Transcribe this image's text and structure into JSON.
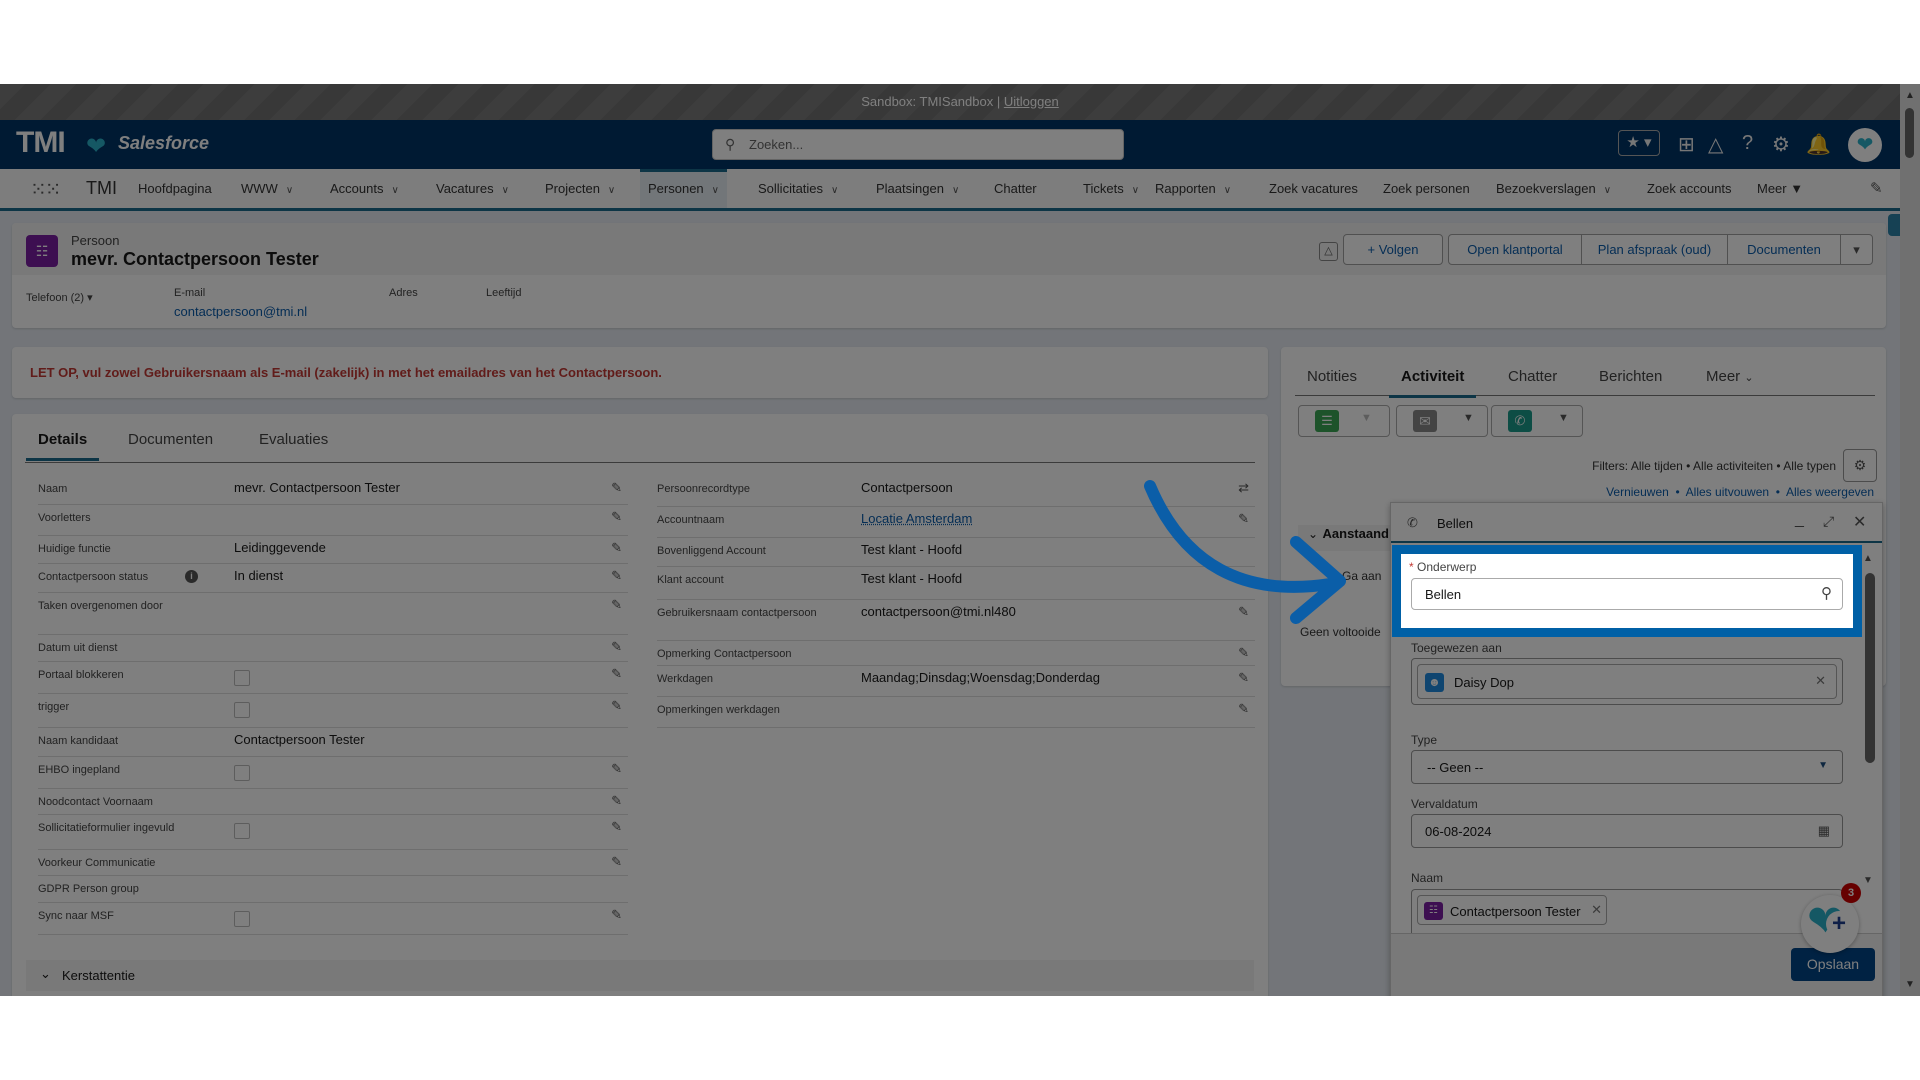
{
  "sandbox": {
    "text": "Sandbox: TMISandbox |",
    "logout": "Uitloggen"
  },
  "header": {
    "brand": "TMI",
    "product": "Salesforce",
    "search_placeholder": "Zoeken...",
    "icons": [
      "favorites-star-icon",
      "add-icon",
      "trailhead-icon",
      "help-icon",
      "settings-gear-icon",
      "notifications-bell-icon",
      "user-avatar"
    ]
  },
  "nav": {
    "app_name": "TMI",
    "active": "Personen",
    "items": [
      {
        "label": "Hoofdpagina",
        "dropdown": false
      },
      {
        "label": "WWW",
        "dropdown": true
      },
      {
        "label": "Accounts",
        "dropdown": true
      },
      {
        "label": "Vacatures",
        "dropdown": true
      },
      {
        "label": "Projecten",
        "dropdown": true
      },
      {
        "label": "Personen",
        "dropdown": true
      },
      {
        "label": "Sollicitaties",
        "dropdown": true
      },
      {
        "label": "Plaatsingen",
        "dropdown": true
      },
      {
        "label": "Chatter",
        "dropdown": false
      },
      {
        "label": "Tickets",
        "dropdown": true
      },
      {
        "label": "Rapporten",
        "dropdown": true
      },
      {
        "label": "Zoek vacatures",
        "dropdown": false
      },
      {
        "label": "Zoek personen",
        "dropdown": false
      },
      {
        "label": "Bezoekverslagen",
        "dropdown": true
      },
      {
        "label": "Zoek accounts",
        "dropdown": false
      },
      {
        "label": "Meer ▼",
        "dropdown": false
      }
    ]
  },
  "record": {
    "object": "Persoon",
    "title": "mevr. Contactpersoon Tester",
    "actions": [
      "Volgen",
      "Open klantportal",
      "Plan afspraak (oud)",
      "Documenten"
    ],
    "highlights": {
      "phone": "Telefoon (2) ▾",
      "email_label": "E-mail",
      "email": "contactpersoon@tmi.nl",
      "address_label": "Adres",
      "age_label": "Leeftijd"
    }
  },
  "warning": "LET OP, vul zowel Gebruikersnaam als E-mail (zakelijk) in met het emailadres van het Contactpersoon.",
  "details": {
    "tabs": [
      "Details",
      "Documenten",
      "Evaluaties"
    ],
    "active_tab": "Details",
    "left": [
      {
        "label": "Naam",
        "value": "mevr. Contactpersoon Tester",
        "edit": true
      },
      {
        "label": "Voorletters",
        "value": "",
        "edit": true
      },
      {
        "label": "Huidige functie",
        "value": "Leidinggevende",
        "edit": true
      },
      {
        "label": "Contactpersoon status",
        "value": "In dienst",
        "edit": true,
        "info": true
      },
      {
        "label": "Taken overgenomen door",
        "value": "",
        "edit": true
      },
      {
        "label": "Datum uit dienst",
        "value": "",
        "edit": true
      },
      {
        "label": "Portaal blokkeren",
        "checkbox": false,
        "edit": true
      },
      {
        "label": "trigger",
        "checkbox": false,
        "edit": true
      },
      {
        "label": "Naam kandidaat",
        "value": "Contactpersoon Tester",
        "edit": false
      },
      {
        "label": "EHBO ingepland",
        "checkbox": false,
        "edit": true
      },
      {
        "label": "Noodcontact Voornaam",
        "value": "",
        "edit": true
      },
      {
        "label": "Sollicitatieformulier ingevuld",
        "checkbox": false,
        "edit": true
      },
      {
        "label": "Voorkeur Communicatie",
        "value": "",
        "edit": true
      },
      {
        "label": "GDPR Person group",
        "value": "",
        "edit": false
      },
      {
        "label": "Sync naar MSF",
        "checkbox": false,
        "edit": true
      }
    ],
    "right": [
      {
        "label": "Persoonrecordtype",
        "value": "Contactpersoon",
        "edit": "change"
      },
      {
        "label": "Accountnaam",
        "value": "Locatie Amsterdam",
        "link": true,
        "edit": true
      },
      {
        "label": "Bovenliggend Account",
        "value": "Test klant - Hoofd",
        "edit": false
      },
      {
        "label": "Klant account",
        "value": "Test klant - Hoofd",
        "edit": false
      },
      {
        "label": "Gebruikersnaam contactpersoon",
        "value": "contactpersoon@tmi.nl480",
        "edit": true
      },
      {
        "label": "Opmerking Contactpersoon",
        "value": "",
        "edit": true
      },
      {
        "label": "Werkdagen",
        "value": "Maandag;Dinsdag;Woensdag;Donderdag",
        "edit": true
      },
      {
        "label": "Opmerkingen werkdagen",
        "value": "",
        "edit": true
      }
    ],
    "section": "Kerstattentie"
  },
  "activity": {
    "tabs": [
      "Notities",
      "Activiteit",
      "Chatter",
      "Berichten",
      "Meer"
    ],
    "active_tab": "Activiteit",
    "filters": "Filters: Alle tijden • Alle activiteiten • Alle typen",
    "links": [
      "Vernieuwen",
      "Alles uitvouwen",
      "Alles weergeven"
    ],
    "upcoming": "Aanstaand",
    "upcoming_text": "Ga aan",
    "none_completed": "Geen voltooide"
  },
  "modal": {
    "title": "Bellen",
    "subject_label": "Onderwerp",
    "subject_value": "Bellen",
    "assigned_label": "Toegewezen aan",
    "assigned_value": "Daisy Dop",
    "type_label": "Type",
    "type_value": "-- Geen --",
    "due_label": "Vervaldatum",
    "due_value": "06-08-2024",
    "name_label": "Naam",
    "name_value": "Contactpersoon Tester",
    "save": "Opslaan",
    "badge_count": "3"
  },
  "colors": {
    "header": "#013466",
    "accent": "#1b6b8c",
    "highlight": "#0060a6",
    "warning": "#c23934",
    "arrow": "#0b5ea8"
  }
}
